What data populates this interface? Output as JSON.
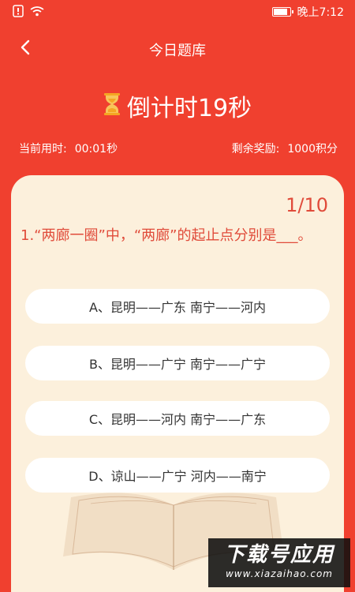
{
  "status_bar": {
    "time": "晚上7:12",
    "colors": {
      "text": "#ffffff"
    },
    "battery_level": 0.85
  },
  "nav": {
    "title": "今日题库",
    "back_icon": "chevron-left-icon"
  },
  "timer": {
    "icon": "hourglass-icon",
    "text": "倒计时19秒"
  },
  "stats": {
    "elapsed_label": "当前用时:",
    "elapsed_value": "00:01秒",
    "reward_label": "剩余奖励:",
    "reward_value": "1000积分"
  },
  "quiz": {
    "progress": "1/10",
    "question": "1.“两廊一圈”中，“两廊”的起止点分别是___。",
    "options": [
      {
        "label": "A、昆明——广东 南宁——河内"
      },
      {
        "label": "B、昆明——广宁 南宁——广宁"
      },
      {
        "label": "C、昆明——河内 南宁——广东"
      },
      {
        "label": "D、谅山——广宁 河内——南宁"
      }
    ]
  },
  "watermark": {
    "main": "下载号应用",
    "url": "www.xiazaihao.com"
  },
  "colors": {
    "header_bg": "#f0402f",
    "card_bg": "#fcf0dc",
    "accent_text": "#e04b3a",
    "hourglass": "#f5a623"
  }
}
